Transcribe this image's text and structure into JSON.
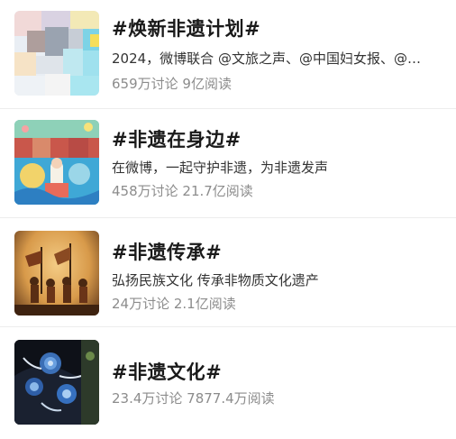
{
  "topics": [
    {
      "title": "#焕新非遗计划#",
      "description": "2024，微博联合 @文旅之声、@中国妇女报、@…",
      "stats": "659万讨论 9亿阅读"
    },
    {
      "title": "#非遗在身边#",
      "description": "在微博，一起守护非遗，为非遗发声",
      "stats": "458万讨论 21.7亿阅读"
    },
    {
      "title": "#非遗传承#",
      "description": "弘扬民族文化 传承非物质文化遗产",
      "stats": "24万讨论 2.1亿阅读"
    },
    {
      "title": "#非遗文化#",
      "stats": "23.4万讨论 7877.4万阅读"
    }
  ],
  "colors": {
    "title": "#1a1a1a",
    "description": "#333333",
    "stats": "#8c8c8c",
    "divider": "#ededed"
  }
}
